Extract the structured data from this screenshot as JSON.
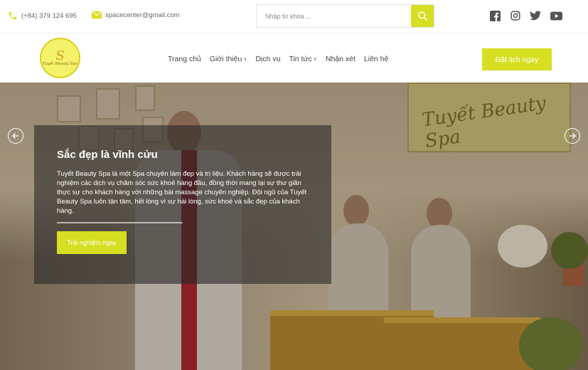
{
  "topbar": {
    "phone": "(+84) 379 124 695",
    "email": "spacecenter@gmail.com",
    "search_placeholder": "Nhập từ khóa ...",
    "social_icons": [
      "facebook-icon",
      "instagram-icon",
      "twitter-icon",
      "youtube-icon"
    ]
  },
  "nav": {
    "logo_text": "Tuyết Beauty Spa",
    "items": [
      {
        "label": "Trang chủ"
      },
      {
        "label": "Giới thiệu"
      },
      {
        "label": "Dịch vụ"
      },
      {
        "label": "Tin tức"
      },
      {
        "label": "Nhận xét"
      },
      {
        "label": "Liên hệ"
      }
    ],
    "cta": "Đặt lịch ngay"
  },
  "hero": {
    "sign_text": "Tuyết Beauty Spa",
    "title": "Sắc đẹp là vĩnh cửu",
    "body": "Tuyết Beauty Spa là một Spa chuyên làm đẹp và trị liệu. Khách hàng sẽ được trải nghiệm các dịch vụ chăm sóc sức khoẻ hàng đầu, đồng thời mang lại sự thư giãn thực sự cho khách hàng với những bài massage chuyên nghiệp. Đội ngũ của Tuyết Beauty Spa luôn tận tâm, hết lòng vì sự hài lòng, sức khoẻ và sắc đẹp của khách hàng.",
    "button": "Trải nghiệm ngay"
  },
  "colors": {
    "accent": "#d7df23",
    "social": "#555555"
  }
}
